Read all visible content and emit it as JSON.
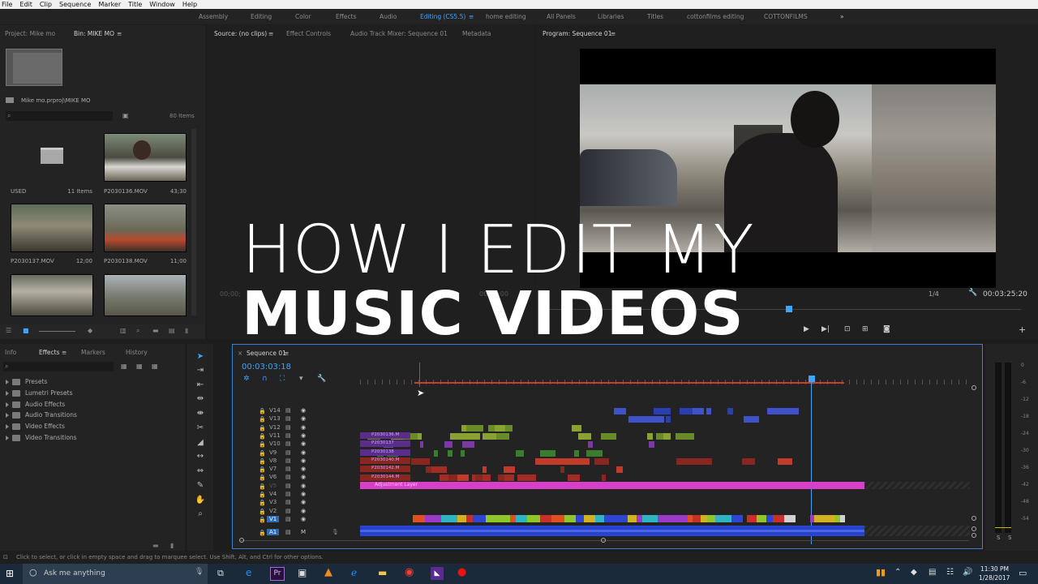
{
  "menu": [
    "File",
    "Edit",
    "Clip",
    "Sequence",
    "Marker",
    "Title",
    "Window",
    "Help"
  ],
  "workspaces": [
    {
      "label": "Assembly",
      "active": false
    },
    {
      "label": "Editing",
      "active": false
    },
    {
      "label": "Color",
      "active": false
    },
    {
      "label": "Effects",
      "active": false
    },
    {
      "label": "Audio",
      "active": false
    },
    {
      "label": "Editing (CS5.5)",
      "active": true
    },
    {
      "label": "home editing",
      "active": false
    },
    {
      "label": "All Panels",
      "active": false
    },
    {
      "label": "Libraries",
      "active": false
    },
    {
      "label": "Titles",
      "active": false
    },
    {
      "label": "cottonfilms editing",
      "active": false
    },
    {
      "label": "COTTONFILMS",
      "active": false
    }
  ],
  "project": {
    "tabs": [
      "Project: Mike mo",
      "Bin: MIKE MO"
    ],
    "path": "Mike mo.prproj\\MIKE MO",
    "item_count": "80 Items",
    "items": [
      {
        "name": "USED",
        "meta": "11 Items",
        "kind": "folder"
      },
      {
        "name": "P2030136.MOV",
        "meta": "43;30",
        "kind": "clip"
      },
      {
        "name": "P2030137.MOV",
        "meta": "12;00",
        "kind": "clip"
      },
      {
        "name": "P2030138.MOV",
        "meta": "11;00",
        "kind": "clip"
      },
      {
        "name": "",
        "meta": "",
        "kind": "clip"
      },
      {
        "name": "",
        "meta": "",
        "kind": "clip"
      }
    ]
  },
  "source": {
    "tabs": [
      "Source: (no clips)",
      "Effect Controls",
      "Audio Track Mixer: Sequence 01",
      "Metadata"
    ],
    "timecode_left": "00;00;",
    "timecode_right": "00;00;00"
  },
  "program": {
    "tab": "Program: Sequence 01",
    "fit": "1/4",
    "duration": "00:03:25:20"
  },
  "effects": {
    "tabs": [
      "Info",
      "Effects",
      "Markers",
      "History"
    ],
    "items": [
      "Presets",
      "Lumetri Presets",
      "Audio Effects",
      "Audio Transitions",
      "Video Effects",
      "Video Transitions"
    ]
  },
  "timeline": {
    "tab": "Sequence 01",
    "timecode": "00:03:03:18",
    "tracks": [
      "V14",
      "V13",
      "V12",
      "V11",
      "V10",
      "V9",
      "V8",
      "V7",
      "V6",
      "V5",
      "V4",
      "V3",
      "V2",
      "V1",
      "A1"
    ],
    "adjustment_label": "Adjustment Layer",
    "clip_labels": [
      "P2030136.M",
      "P2030137",
      "P2030138",
      "P2030140.M",
      "P2030142.M",
      "P2030144.M"
    ]
  },
  "meters": [
    "0",
    "-6",
    "-12",
    "-18",
    "-24",
    "-30",
    "-36",
    "-42",
    "-48",
    "-54"
  ],
  "meter_solo": [
    "S",
    "S"
  ],
  "overlay": {
    "line1": "HOW I EDIT MY",
    "line2": "MUSIC VIDEOS"
  },
  "status": "Click to select, or click in empty space and drag to marquee select. Use Shift, Alt, and Ctrl for other options.",
  "taskbar": {
    "search_placeholder": "Ask me anything",
    "time": "11:30 PM",
    "date": "1/28/2017"
  },
  "colors": {
    "accent": "#3ea5ff",
    "adjustment": "#d63fc8",
    "audio": "#1f3fbf",
    "inout": "#d23b2f"
  }
}
